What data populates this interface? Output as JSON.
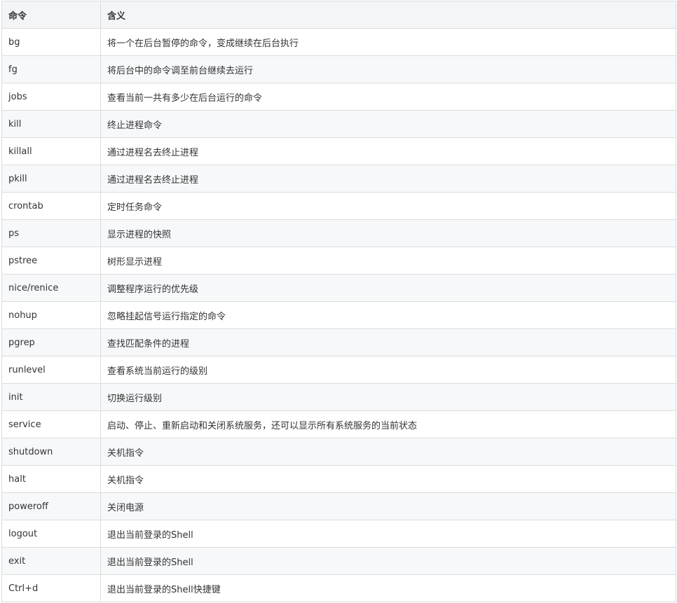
{
  "table": {
    "headers": [
      "命令",
      "含义"
    ],
    "rows": [
      {
        "cmd": "bg",
        "desc": "将一个在后台暂停的命令，变成继续在后台执行"
      },
      {
        "cmd": "fg",
        "desc": "将后台中的命令调至前台继续去运行"
      },
      {
        "cmd": "jobs",
        "desc": "查看当前一共有多少在后台运行的命令"
      },
      {
        "cmd": "kill",
        "desc": "终止进程命令"
      },
      {
        "cmd": "killall",
        "desc": "通过进程名去终止进程"
      },
      {
        "cmd": "pkill",
        "desc": "通过进程名去终止进程"
      },
      {
        "cmd": "crontab",
        "desc": "定时任务命令"
      },
      {
        "cmd": "ps",
        "desc": "显示进程的快照"
      },
      {
        "cmd": "pstree",
        "desc": "树形显示进程"
      },
      {
        "cmd": "nice/renice",
        "desc": "调整程序运行的优先级"
      },
      {
        "cmd": "nohup",
        "desc": "忽略挂起信号运行指定的命令"
      },
      {
        "cmd": "pgrep",
        "desc": "查找匹配条件的进程"
      },
      {
        "cmd": "runlevel",
        "desc": "查看系统当前运行的级别"
      },
      {
        "cmd": "init",
        "desc": "切换运行级别"
      },
      {
        "cmd": "service",
        "desc": "启动、停止、重新启动和关闭系统服务，还可以显示所有系统服务的当前状态"
      },
      {
        "cmd": "shutdown",
        "desc": "关机指令"
      },
      {
        "cmd": "halt",
        "desc": "关机指令"
      },
      {
        "cmd": "poweroff",
        "desc": "关闭电源"
      },
      {
        "cmd": "logout",
        "desc": "退出当前登录的Shell"
      },
      {
        "cmd": "exit",
        "desc": "退出当前登录的Shell"
      },
      {
        "cmd": "Ctrl+d",
        "desc": "退出当前登录的Shell快捷键"
      }
    ]
  }
}
